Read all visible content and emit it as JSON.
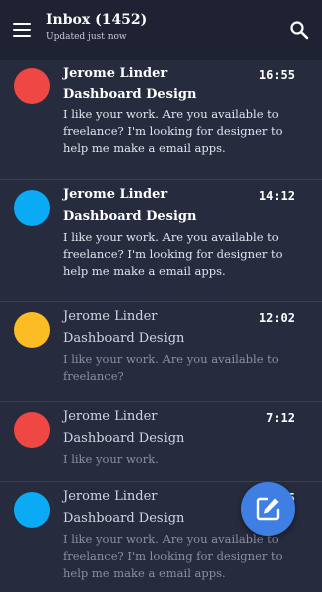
{
  "header": {
    "title": "Inbox (1452)",
    "subtitle": "Updated just now",
    "menu_icon": "menu-icon",
    "search_icon": "search-icon"
  },
  "emails": [
    {
      "sender": "Jerome Linder",
      "time": "16:55",
      "subject": "Dashboard Design",
      "preview": "I like your work. Are you available to freelance? I'm looking for designer to help me make a email apps.",
      "avatar_color": "#ef4744",
      "unread": true
    },
    {
      "sender": "Jerome Linder",
      "time": "14:12",
      "subject": "Dashboard Design",
      "preview": "I like your work. Are you available to freelance? I'm looking for designer to help me make a email apps.",
      "avatar_color": "#0aaaf5",
      "unread": true
    },
    {
      "sender": "Jerome Linder",
      "time": "12:02",
      "subject": "Dashboard Design",
      "preview": "I like your work. Are you available to freelance?",
      "avatar_color": "#fbbc24",
      "unread": false
    },
    {
      "sender": "Jerome Linder",
      "time": "7:12",
      "subject": "Dashboard Design",
      "preview": "I like your work.",
      "avatar_color": "#ef4744",
      "unread": false
    },
    {
      "sender": "Jerome Linder",
      "time": "5:55",
      "subject": "Dashboard Design",
      "preview": "I like your work. Are you available to freelance? I'm looking for designer to help me make a email apps.",
      "avatar_color": "#0aaaf5",
      "unread": false
    }
  ],
  "fab": {
    "icon": "compose-icon",
    "color": "#3f7fe3"
  }
}
